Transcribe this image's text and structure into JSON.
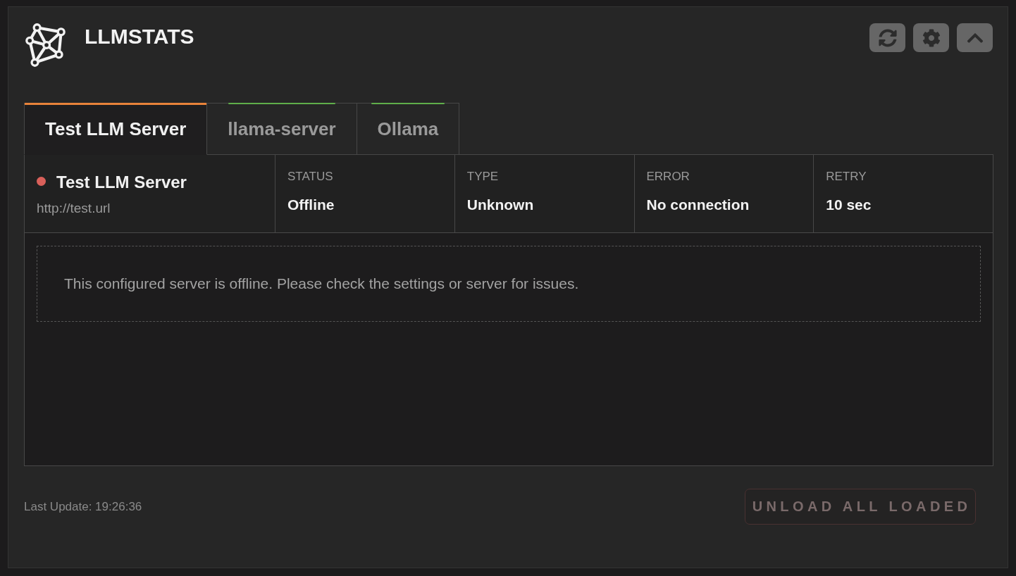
{
  "header": {
    "title": "LLMSTATS"
  },
  "tabs": [
    {
      "label": "Test LLM Server",
      "selected": true,
      "color": "#e8833a"
    },
    {
      "label": "llama-server",
      "selected": false,
      "color": "#5fae4a"
    },
    {
      "label": "Ollama",
      "selected": false,
      "color": "#5fae4a"
    }
  ],
  "server": {
    "name": "Test LLM Server",
    "url": "http://test.url",
    "color": "#d9605a",
    "stats": [
      {
        "label": "STATUS",
        "value": "Offline"
      },
      {
        "label": "TYPE",
        "value": "Unknown"
      },
      {
        "label": "ERROR",
        "value": "No connection"
      },
      {
        "label": "RETRY",
        "value": "10 sec"
      }
    ]
  },
  "message": "This configured server is offline. Please check the settings or server for issues.",
  "footer": {
    "last_update": "Last Update: 19:26:36",
    "button": {
      "label": "UNLOAD ALL LOADED",
      "disabled": true
    }
  }
}
